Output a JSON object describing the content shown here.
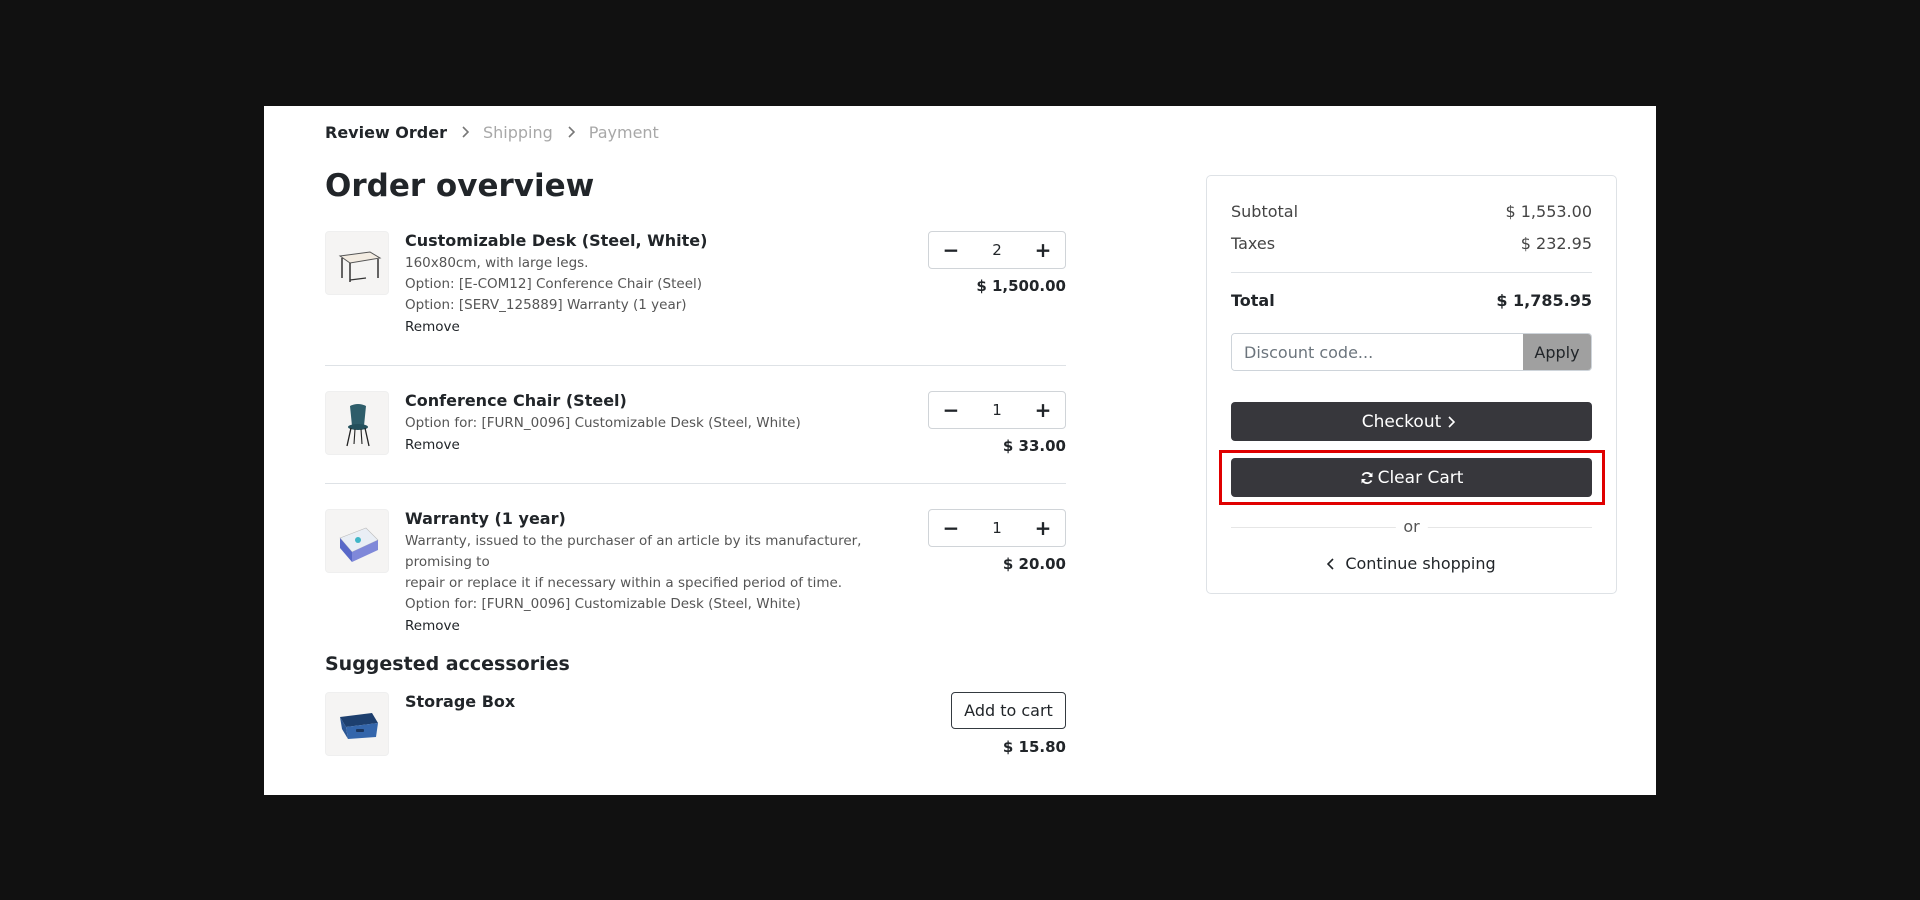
{
  "breadcrumb": {
    "steps": [
      "Review Order",
      "Shipping",
      "Payment"
    ]
  },
  "page_title": "Order overview",
  "cart_lines": [
    {
      "name": "Customizable Desk (Steel, White)",
      "desc": [
        "160x80cm, with large legs.",
        "Option: [E-COM12] Conference Chair (Steel)",
        "Option: [SERV_125889] Warranty (1 year)"
      ],
      "remove": "Remove",
      "qty": "2",
      "price": "$ 1,500.00",
      "icon": "desk-image"
    },
    {
      "name": "Conference Chair (Steel)",
      "desc": [
        "Option for: [FURN_0096] Customizable Desk (Steel, White)"
      ],
      "remove": "Remove",
      "qty": "1",
      "price": "$ 33.00",
      "icon": "chair-image"
    },
    {
      "name": "Warranty (1 year)",
      "desc": [
        "Warranty, issued to the purchaser of an article by its manufacturer, promising to",
        "repair or replace it if necessary within a specified period of time.",
        "Option for: [FURN_0096] Customizable Desk (Steel, White)"
      ],
      "remove": "Remove",
      "qty": "1",
      "price": "$ 20.00",
      "icon": "warranty-box-image"
    }
  ],
  "accessories": {
    "title": "Suggested accessories",
    "items": [
      {
        "name": "Storage Box",
        "button": "Add to cart",
        "price": "$ 15.80",
        "icon": "storage-box-image"
      }
    ]
  },
  "summary": {
    "subtotal_label": "Subtotal",
    "subtotal_value": "$ 1,553.00",
    "taxes_label": "Taxes",
    "taxes_value": "$ 232.95",
    "total_label": "Total",
    "total_value": "$ 1,785.95",
    "discount_placeholder": "Discount code...",
    "apply_label": "Apply",
    "checkout_label": "Checkout",
    "clear_cart_label": "Clear Cart",
    "or_label": "or",
    "continue_label": "Continue shopping"
  },
  "colors": {
    "dark_button": "#37373c",
    "highlight": "#e00000",
    "apply_button": "#a0a0a0"
  }
}
